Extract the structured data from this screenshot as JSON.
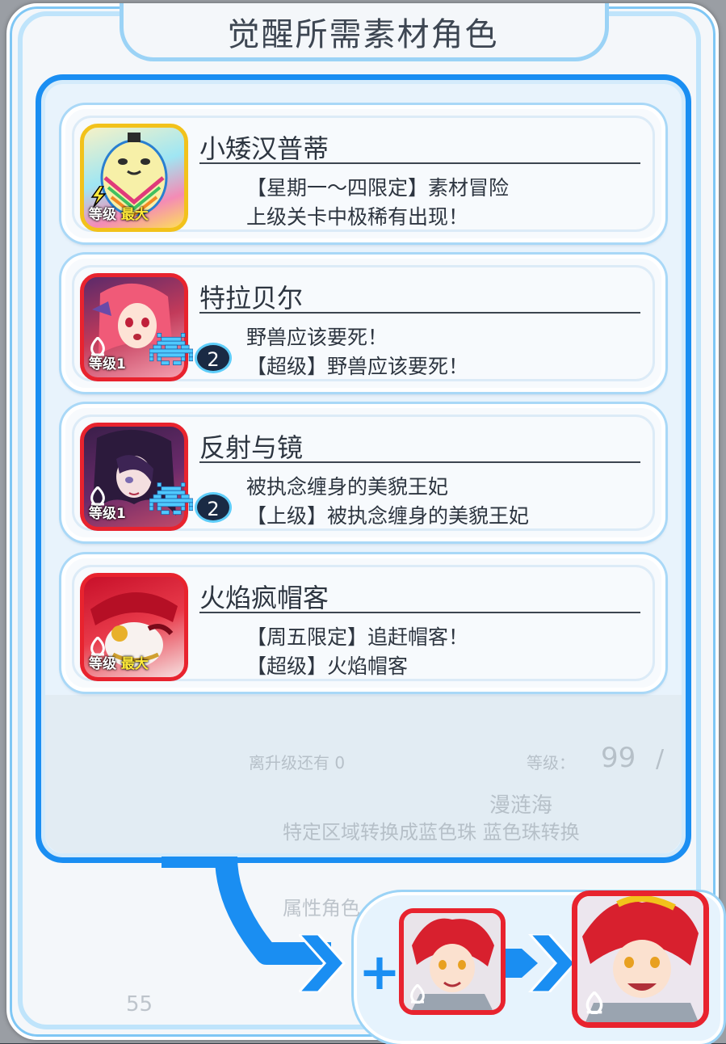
{
  "title": "觉醒所需素材角色",
  "materials": [
    {
      "name": "小矮汉普蒂",
      "line1": "【星期一～四限定】素材冒险",
      "line2": "上级关卡中极稀有出现！",
      "level_label": "等级",
      "level_value": "最大",
      "element": "light",
      "frame_color": "#f2c21b",
      "badge": null
    },
    {
      "name": "特拉贝尔",
      "line1": "野兽应该要死！",
      "line2": "【超级】野兽应该要死！",
      "level_label": "等级",
      "level_value": "1",
      "element": "fire",
      "frame_color": "#e8232e",
      "badge": "2"
    },
    {
      "name": "反射与镜",
      "line1": "被执念缠身的美貌王妃",
      "line2": "【上级】被执念缠身的美貌王妃",
      "level_label": "等级",
      "level_value": "1",
      "element": "fire",
      "frame_color": "#e8232e",
      "badge": "2"
    },
    {
      "name": "火焰疯帽客",
      "line1": "【周五限定】追赶帽客！",
      "line2": "【超级】火焰帽客",
      "level_label": "等级",
      "level_value": "最大",
      "element": "fire",
      "frame_color": "#e8232e",
      "badge": null
    }
  ],
  "evolution": {
    "plus_symbol": "+",
    "base_element": "fire",
    "result_element": "fire"
  },
  "background_text": {
    "b1": "离升级还有 0",
    "b2": "等级：",
    "b3": "99",
    "b4": "/",
    "b5": "漫涟海",
    "b6": "特定区域转换成蓝色珠 蓝色珠转换",
    "b7": "属性角色",
    "b8": "55"
  }
}
